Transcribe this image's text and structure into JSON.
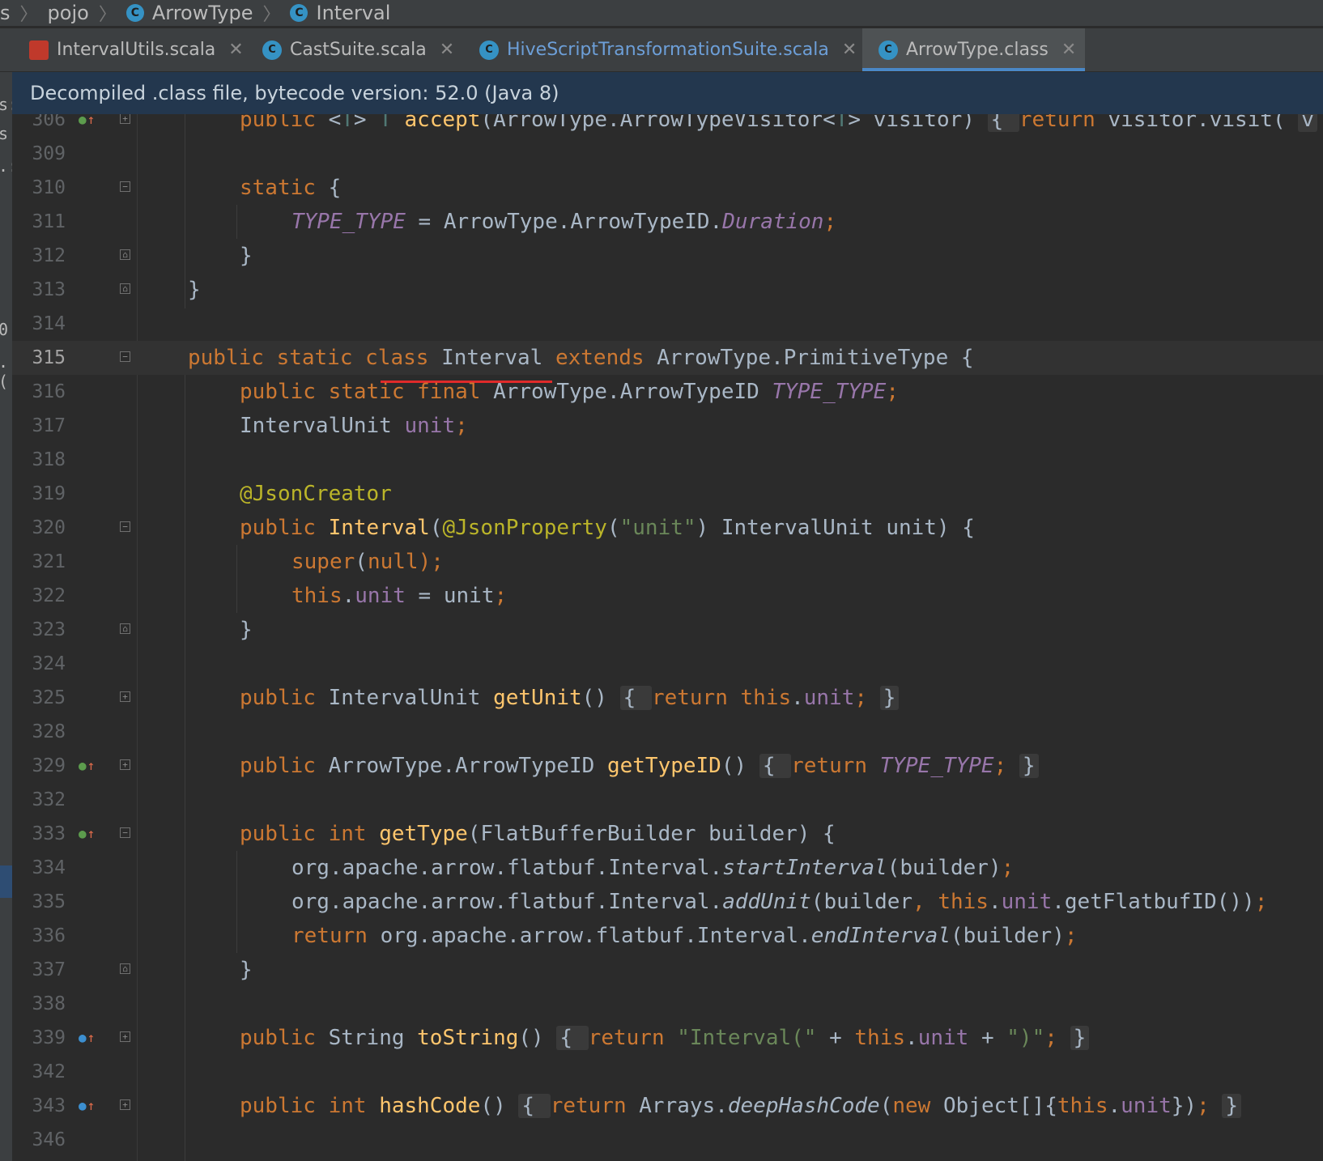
{
  "breadcrumb": [
    "s",
    "pojo",
    "ArrowType",
    "Interval"
  ],
  "tabs": [
    {
      "label": "IntervalUtils.scala",
      "icon": "scala-file-icon",
      "active": false
    },
    {
      "label": "CastSuite.scala",
      "icon": "scala-class-icon",
      "active": false
    },
    {
      "label": "HiveScriptTransformationSuite.scala",
      "icon": "scala-class-icon",
      "active": false
    },
    {
      "label": "ArrowType.class",
      "icon": "java-class-icon",
      "active": true
    }
  ],
  "banner": "Decompiled .class file, bytecode version: 52.0 (Java 8)",
  "left_strip": [
    "s:",
    "s",
    ".:",
    "0",
    ".("
  ],
  "line_numbers": [
    "306",
    "309",
    "310",
    "311",
    "312",
    "313",
    "314",
    "315",
    "316",
    "317",
    "318",
    "319",
    "320",
    "321",
    "322",
    "323",
    "324",
    "325",
    "328",
    "329",
    "332",
    "333",
    "334",
    "335",
    "336",
    "337",
    "338",
    "339",
    "342",
    "343",
    "346"
  ],
  "current_line": "315",
  "code": {
    "l306": {
      "a": "public ",
      "b": "<",
      "c": "T",
      "d": "> ",
      "e": "T ",
      "f": "accept",
      "g": "(ArrowType.ArrowTypeVisitor<",
      "h": "T",
      "i": "> visitor) ",
      "j": "{ ",
      "k": "return ",
      "l": "visitor.visit( ",
      "m": "v"
    },
    "l310": {
      "a": "static ",
      "b": "{"
    },
    "l311": {
      "a": "TYPE_TYPE",
      "b": " = ArrowType.ArrowTypeID.",
      "c": "Duration",
      "d": ";"
    },
    "l312": {
      "a": "}"
    },
    "l313": {
      "a": "}"
    },
    "l315": {
      "a": "public static class ",
      "b": "Interval ",
      "c": "extends ",
      "d": "ArrowType.PrimitiveType {"
    },
    "l316": {
      "a": "public static final ",
      "b": "ArrowType.ArrowTypeID ",
      "c": "TYPE_TYPE",
      "d": ";"
    },
    "l317": {
      "a": "IntervalUnit ",
      "b": "unit",
      "c": ";"
    },
    "l319": {
      "a": "@JsonCreator"
    },
    "l320": {
      "a": "public ",
      "b": "Interval",
      "c": "(",
      "d": "@JsonProperty",
      "e": "(",
      "f": "\"unit\"",
      "g": ") IntervalUnit unit) {"
    },
    "l321": {
      "a": "super",
      "b": "(",
      "c": "null",
      "d": ");"
    },
    "l322": {
      "a": "this",
      "b": ".",
      "c": "unit",
      "d": " = unit",
      "e": ";"
    },
    "l323": {
      "a": "}"
    },
    "l325": {
      "a": "public ",
      "b": "IntervalUnit ",
      "c": "getUnit",
      "d": "() ",
      "e": "{ ",
      "f": "return this",
      "g": ".",
      "h": "unit",
      "i": "; ",
      "j": "}"
    },
    "l329": {
      "a": "public ",
      "b": "ArrowType.ArrowTypeID ",
      "c": "getTypeID",
      "d": "() ",
      "e": "{ ",
      "f": "return ",
      "g": "TYPE_TYPE",
      "h": "; ",
      "i": "}"
    },
    "l333": {
      "a": "public int ",
      "b": "getType",
      "c": "(FlatBufferBuilder builder) {"
    },
    "l334": {
      "a": "org.apache.arrow.flatbuf.Interval.",
      "b": "startInterval",
      "c": "(builder)",
      "d": ";"
    },
    "l335": {
      "a": "org.apache.arrow.flatbuf.Interval.",
      "b": "addUnit",
      "c": "(builder",
      "d": ", this",
      "e": ".",
      "f": "unit",
      "g": ".getFlatbufID())",
      "h": ";"
    },
    "l336": {
      "a": "return ",
      "b": "org.apache.arrow.flatbuf.Interval.",
      "c": "endInterval",
      "d": "(builder)",
      "e": ";"
    },
    "l337": {
      "a": "}"
    },
    "l339": {
      "a": "public ",
      "b": "String ",
      "c": "toString",
      "d": "() ",
      "e": "{ ",
      "f": "return ",
      "g": "\"Interval(\" ",
      "h": "+ ",
      "i": "this",
      "j": ".",
      "k": "unit ",
      "l": "+ ",
      "m": "\")\"",
      "n": "; ",
      "o": "}"
    },
    "l343": {
      "a": "public int ",
      "b": "hashCode",
      "c": "() ",
      "d": "{ ",
      "e": "return ",
      "f": "Arrays.",
      "g": "deepHashCode",
      "h": "(",
      "i": "new ",
      "j": "Object[]{",
      "k": "this",
      "l": ".",
      "m": "unit",
      "n": "})",
      "o": "; ",
      "p": "}"
    }
  },
  "colors": {
    "keyword": "#cc7832",
    "method": "#ffc66d",
    "field": "#9876aa",
    "annotation": "#bbb529",
    "string": "#6a8759",
    "text": "#a9b7c6",
    "background": "#2b2b2b",
    "banner": "#23374e",
    "highlight_underline": "#e02a2a"
  }
}
